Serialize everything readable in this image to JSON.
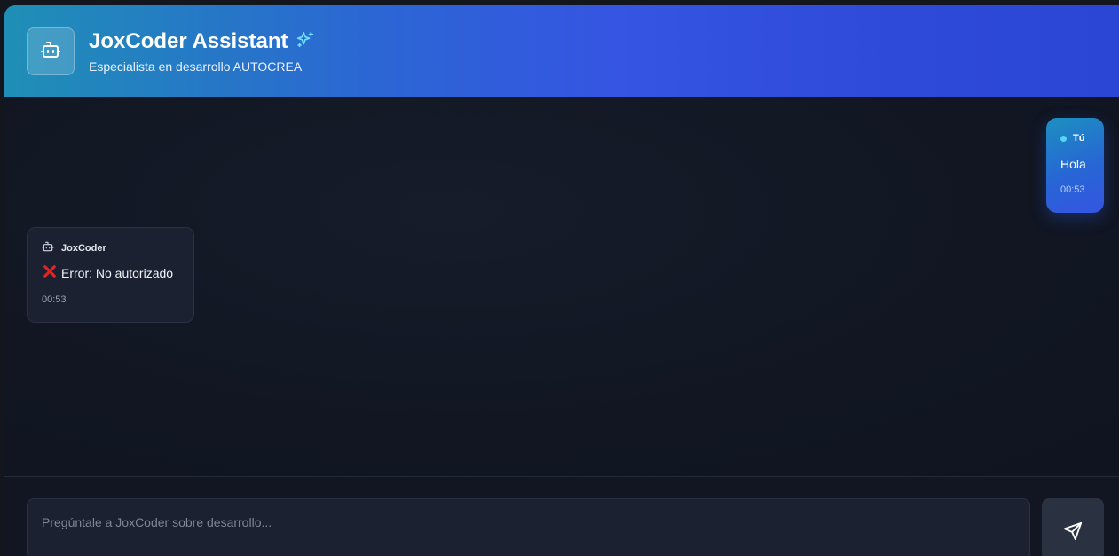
{
  "header": {
    "title": "JoxCoder Assistant",
    "subtitle": "Especialista en desarrollo AUTOCREA",
    "icon": "robot-icon",
    "title_icon": "sparkles-icon",
    "gradient_colors": [
      "#1f8fb6",
      "#3555e2",
      "#2b46d4"
    ]
  },
  "messages": [
    {
      "role": "user",
      "author": "Tú",
      "text": "Hola",
      "time": "00:53",
      "indicator_color": "#56d6f2"
    },
    {
      "role": "assistant",
      "author": "JoxCoder",
      "icon": "robot-icon",
      "status_icon": "x-mark-icon",
      "status_color": "#e02424",
      "text": "Error: No autorizado",
      "time": "00:53"
    }
  ],
  "composer": {
    "placeholder": "Pregúntale a JoxCoder sobre desarrollo...",
    "value": "",
    "send_icon": "send-icon"
  }
}
